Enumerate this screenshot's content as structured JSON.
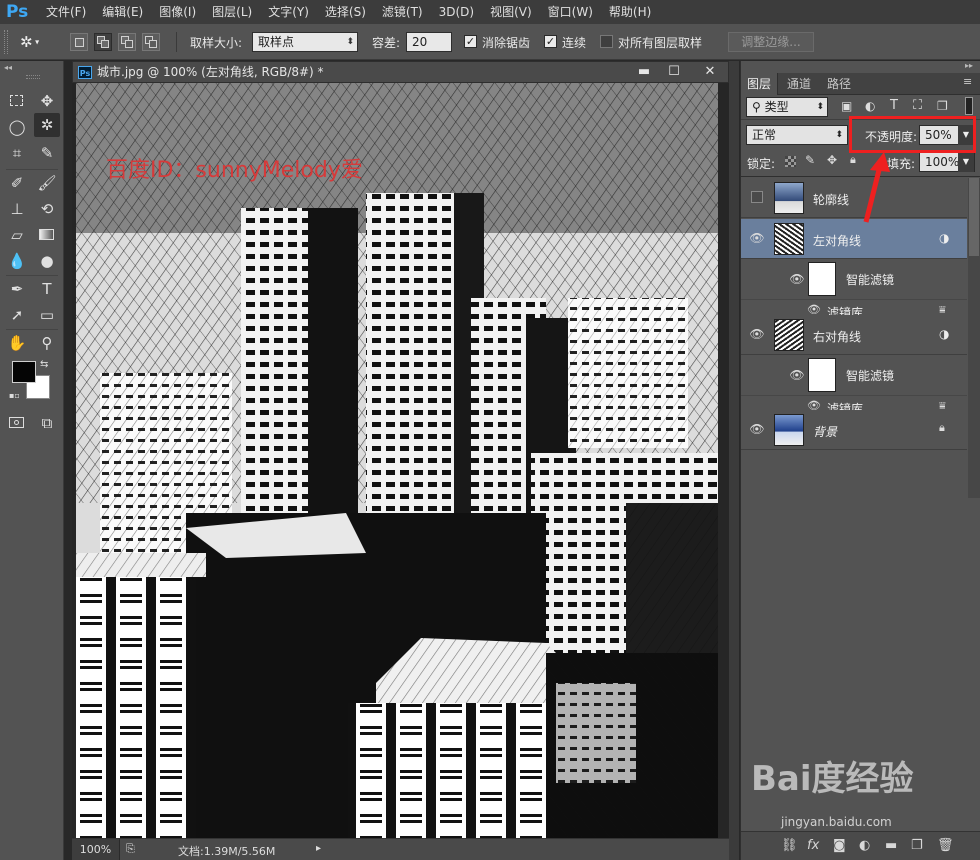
{
  "app": {
    "logo": "Ps"
  },
  "menu": [
    "文件(F)",
    "编辑(E)",
    "图像(I)",
    "图层(L)",
    "文字(Y)",
    "选择(S)",
    "滤镜(T)",
    "3D(D)",
    "视图(V)",
    "窗口(W)",
    "帮助(H)"
  ],
  "options": {
    "sample_size_label": "取样大小:",
    "sample_size_value": "取样点",
    "tolerance_label": "容差:",
    "tolerance_value": "20",
    "antialias_label": "消除锯齿",
    "antialias_checked": true,
    "contiguous_label": "连续",
    "contiguous_checked": true,
    "sample_all_label": "对所有图层取样",
    "sample_all_checked": false,
    "refine_edge_label": "调整边缘..."
  },
  "document": {
    "tab_title": "城市.jpg @ 100% (左对角线, RGB/8#) *",
    "zoom": "100%",
    "doc_size": "文档:1.39M/5.56M",
    "watermark_id": "百度ID：sunnyMelody爱"
  },
  "panel": {
    "tabs": [
      "图层",
      "通道",
      "路径"
    ],
    "filter_kind": "类型",
    "blend_mode": "正常",
    "opacity_label": "不透明度:",
    "opacity_value": "50%",
    "lock_label": "锁定:",
    "fill_label": "填充:",
    "fill_value": "100%",
    "layers": [
      {
        "name": "轮廓线",
        "visible": false,
        "selected": false
      },
      {
        "name": "左对角线",
        "visible": true,
        "selected": true,
        "smart_filter": "智能滤镜",
        "filter": "滤镜库"
      },
      {
        "name": "右对角线",
        "visible": true,
        "selected": false,
        "smart_filter": "智能滤镜",
        "filter": "滤镜库"
      },
      {
        "name": "背景",
        "visible": true,
        "selected": false,
        "locked": true
      }
    ]
  },
  "site_watermark": {
    "brand": "Bai度经验",
    "url": "jingyan.baidu.com"
  },
  "colors": {
    "highlight": "#ee2020",
    "selected_layer": "#6a7f9d",
    "panel_bg": "#535353"
  }
}
